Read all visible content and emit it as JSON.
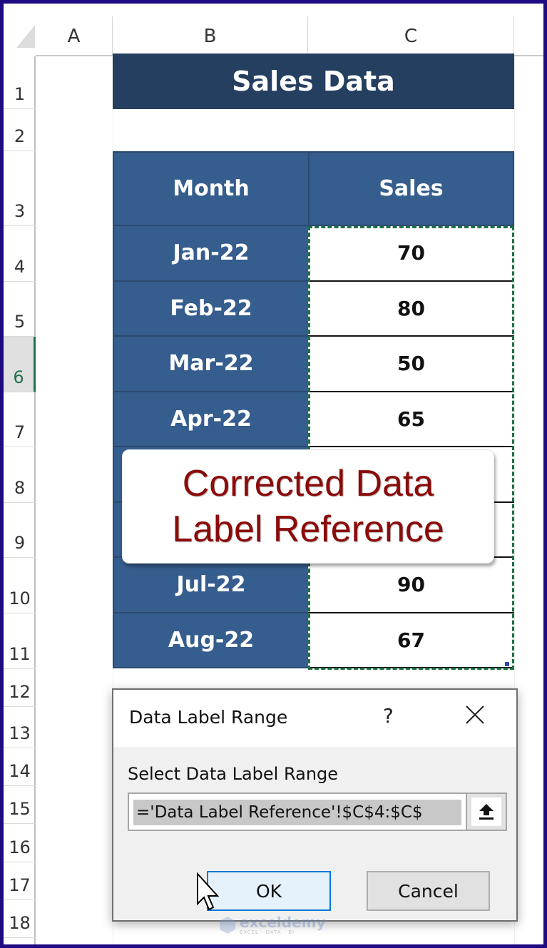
{
  "spreadsheet": {
    "columns": [
      "A",
      "B",
      "C"
    ],
    "rows": [
      "1",
      "2",
      "3",
      "4",
      "5",
      "6",
      "7",
      "8",
      "9",
      "10",
      "11",
      "12",
      "13",
      "14",
      "15",
      "16",
      "17",
      "18"
    ],
    "active_row": "6",
    "title": "Sales Data",
    "table": {
      "headers": {
        "month": "Month",
        "sales": "Sales"
      },
      "rows": [
        {
          "month": "Jan-22",
          "sales": "70"
        },
        {
          "month": "Feb-22",
          "sales": "80"
        },
        {
          "month": "Mar-22",
          "sales": "50"
        },
        {
          "month": "Apr-22",
          "sales": "65"
        },
        {
          "month": "",
          "sales": ""
        },
        {
          "month": "",
          "sales": ""
        },
        {
          "month": "Jul-22",
          "sales": "90"
        },
        {
          "month": "Aug-22",
          "sales": "67"
        }
      ]
    }
  },
  "callout": {
    "line1": "Corrected Data",
    "line2": "Label Reference",
    "color": "#8b0a0a"
  },
  "dialog": {
    "title": "Data Label Range",
    "help_label": "?",
    "close_icon": "close-icon",
    "field_label": "Select Data Label Range",
    "field_value": "='Data Label Reference'!$C$4:$C$",
    "collapse_icon": "upload-arrow-icon",
    "ok_label": "OK",
    "cancel_label": "Cancel"
  },
  "watermark": {
    "name": "exceldemy",
    "tagline": "EXCEL · DATA · BI"
  },
  "colors": {
    "frame": "#1f0a82",
    "title_banner": "#253f60",
    "table_header": "#355d8d",
    "marquee": "#1d7044",
    "ok_border": "#0078d7"
  }
}
